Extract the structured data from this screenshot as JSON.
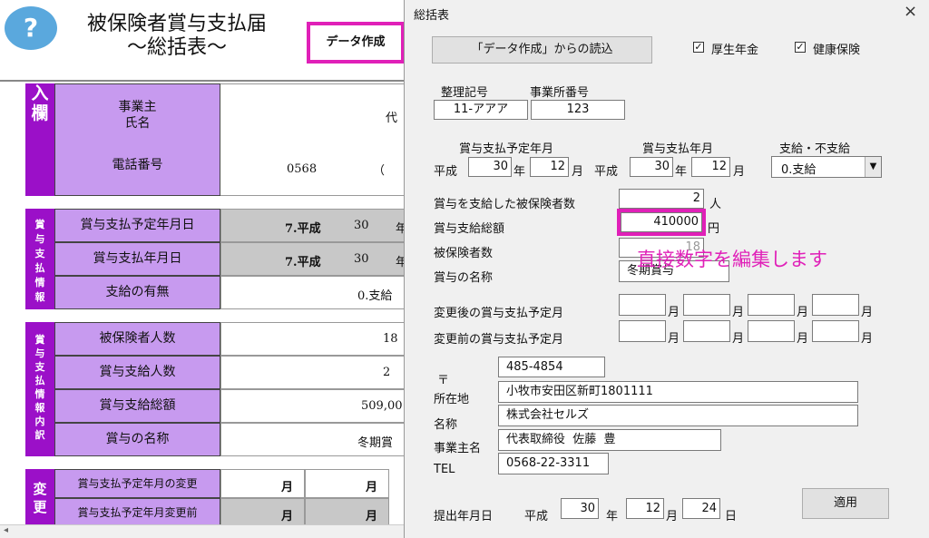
{
  "sheet": {
    "help_icon": "?",
    "title_line1": "被保険者賞与支払届",
    "title_line2": "～総括表～",
    "data_button": "データ作成",
    "owner_section_side": "入\n欄",
    "owner_label": "事業主\n氏名",
    "owner_value_partial": "代",
    "phone_label": "電話番号",
    "phone_value": "0568",
    "phone_paren": "（",
    "pay_info_side": "賞\n与\n支\n払\n情\n報",
    "pay_rows": [
      {
        "label": "賞与支払予定年月日",
        "value": "7.平成",
        "value2": "30",
        "suffix": "年"
      },
      {
        "label": "賞与支払年月日",
        "value": "7.平成",
        "value2": "30",
        "suffix": "年"
      },
      {
        "label": "支給の有無",
        "value": "0.支給",
        "value2": "",
        "suffix": ""
      }
    ],
    "breakdown_side": "賞\n与\n支\n払\n情\n報\n内\n訳",
    "breakdown_rows": [
      {
        "label": "被保険者人数",
        "value": "18"
      },
      {
        "label": "賞与支給人数",
        "value": "2"
      },
      {
        "label": "賞与支給総額",
        "value": "509,00"
      },
      {
        "label": "賞与の名称",
        "value": "冬期賞"
      }
    ],
    "change_side": "変\n更",
    "change_rows": [
      {
        "label": "賞与支払予定年月の変更",
        "m1": "月",
        "m2": "月"
      },
      {
        "label": "賞与支払予定年月変更前",
        "m1": "月",
        "m2": "月"
      }
    ]
  },
  "dialog": {
    "title": "総括表",
    "close": "×",
    "load_button": "「データ作成」からの読込",
    "check_pension": {
      "label": "厚生年金",
      "checked": "✓"
    },
    "check_health": {
      "label": "健康保険",
      "checked": "✓"
    },
    "seiri_label": "整理記号",
    "seiri_value": "11-アアア",
    "office_label": "事業所番号",
    "office_value": "123",
    "planned_label": "賞与支払予定年月",
    "planned_era": "平成",
    "planned_year": "30",
    "planned_month": "12",
    "actual_label": "賞与支払年月",
    "actual_era": "平成",
    "actual_year": "30",
    "actual_month": "12",
    "year_unit": "年",
    "month_unit": "月",
    "pay_type_label": "支給・不支給",
    "pay_type_value": "0.支給",
    "paid_count_label": "賞与を支給した被保険者数",
    "paid_count_value": "2",
    "person_unit": "人",
    "total_label": "賞与支給総額",
    "total_value": "410000",
    "yen_unit": "円",
    "insured_label": "被保険者数",
    "insured_value": "18",
    "bonus_name_label": "賞与の名称",
    "bonus_name_value": "冬期賞与",
    "after_change_label": "変更後の賞与支払予定月",
    "before_change_label": "変更前の賞与支払予定月",
    "zip_label": "〒",
    "zip_value": "485-4854",
    "address_label": "所在地",
    "address_value": "小牧市安田区新町1801111",
    "name_label": "名称",
    "name_value": "株式会社セルズ",
    "owner_label": "事業主名",
    "owner_value": "代表取締役  佐藤  豊",
    "tel_label": "TEL",
    "tel_value": "0568-22-3311",
    "submit_label": "提出年月日",
    "submit_era": "平成",
    "submit_year": "30",
    "submit_month": "12",
    "submit_day": "24",
    "day_unit": "日",
    "apply_button": "適用",
    "annotation": "直接数字を編集します",
    "highlight_color": "#e020b8"
  }
}
